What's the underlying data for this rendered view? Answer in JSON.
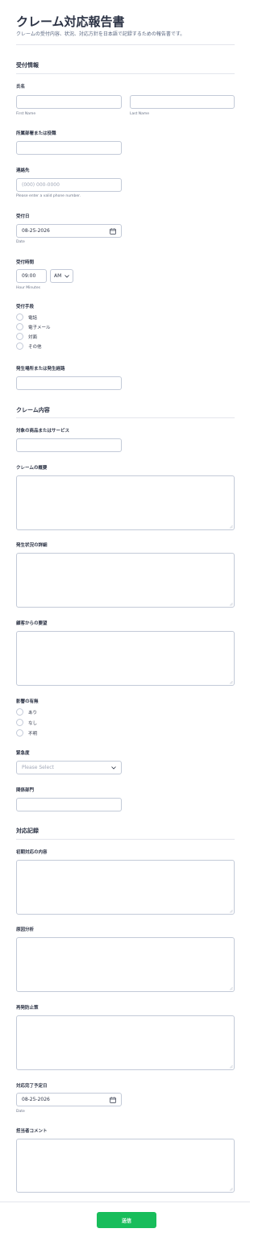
{
  "header": {
    "title": "クレーム対応報告書",
    "subtitle": "クレームの受付内容、状況、対応方針を日本語で記録するための報告書です。"
  },
  "sections": {
    "reception": "受付情報",
    "complaint": "クレーム内容",
    "response": "対応記録"
  },
  "fields": {
    "name": {
      "label": "氏名",
      "first_sub": "First Name",
      "last_sub": "Last Name"
    },
    "department": {
      "label": "所属部署または役職"
    },
    "contact": {
      "label": "連絡先",
      "placeholder": "(000) 000-0000",
      "sub": "Please enter a valid phone number."
    },
    "received_date": {
      "label": "受付日",
      "value": "08-25-2026",
      "sub": "Date"
    },
    "received_time": {
      "label": "受付時間",
      "value": "09:00",
      "ampm": "AM",
      "sub": "Hour Minutes"
    },
    "method": {
      "label": "受付手段",
      "options": [
        "電話",
        "電子メール",
        "対面",
        "その他"
      ]
    },
    "place": {
      "label": "発生場所または発生経路"
    },
    "product": {
      "label": "対象の商品またはサービス"
    },
    "summary": {
      "label": "クレームの概要"
    },
    "details": {
      "label": "発生状況の詳細"
    },
    "request": {
      "label": "顧客からの要望"
    },
    "impact": {
      "label": "影響の有無",
      "options": [
        "あり",
        "なし",
        "不明"
      ]
    },
    "urgency": {
      "label": "緊急度",
      "placeholder": "Please Select"
    },
    "related_dept": {
      "label": "関係部門"
    },
    "initial_response": {
      "label": "初期対応の内容"
    },
    "cause": {
      "label": "原因分析"
    },
    "prevention": {
      "label": "再発防止策"
    },
    "due_date": {
      "label": "対応完了予定日",
      "value": "08-25-2026",
      "sub": "Date"
    },
    "comment": {
      "label": "担当者コメント"
    }
  },
  "submit_label": "送信",
  "colors": {
    "accent": "#18bd5b",
    "border": "#c3cad8",
    "text": "#2c3345"
  }
}
